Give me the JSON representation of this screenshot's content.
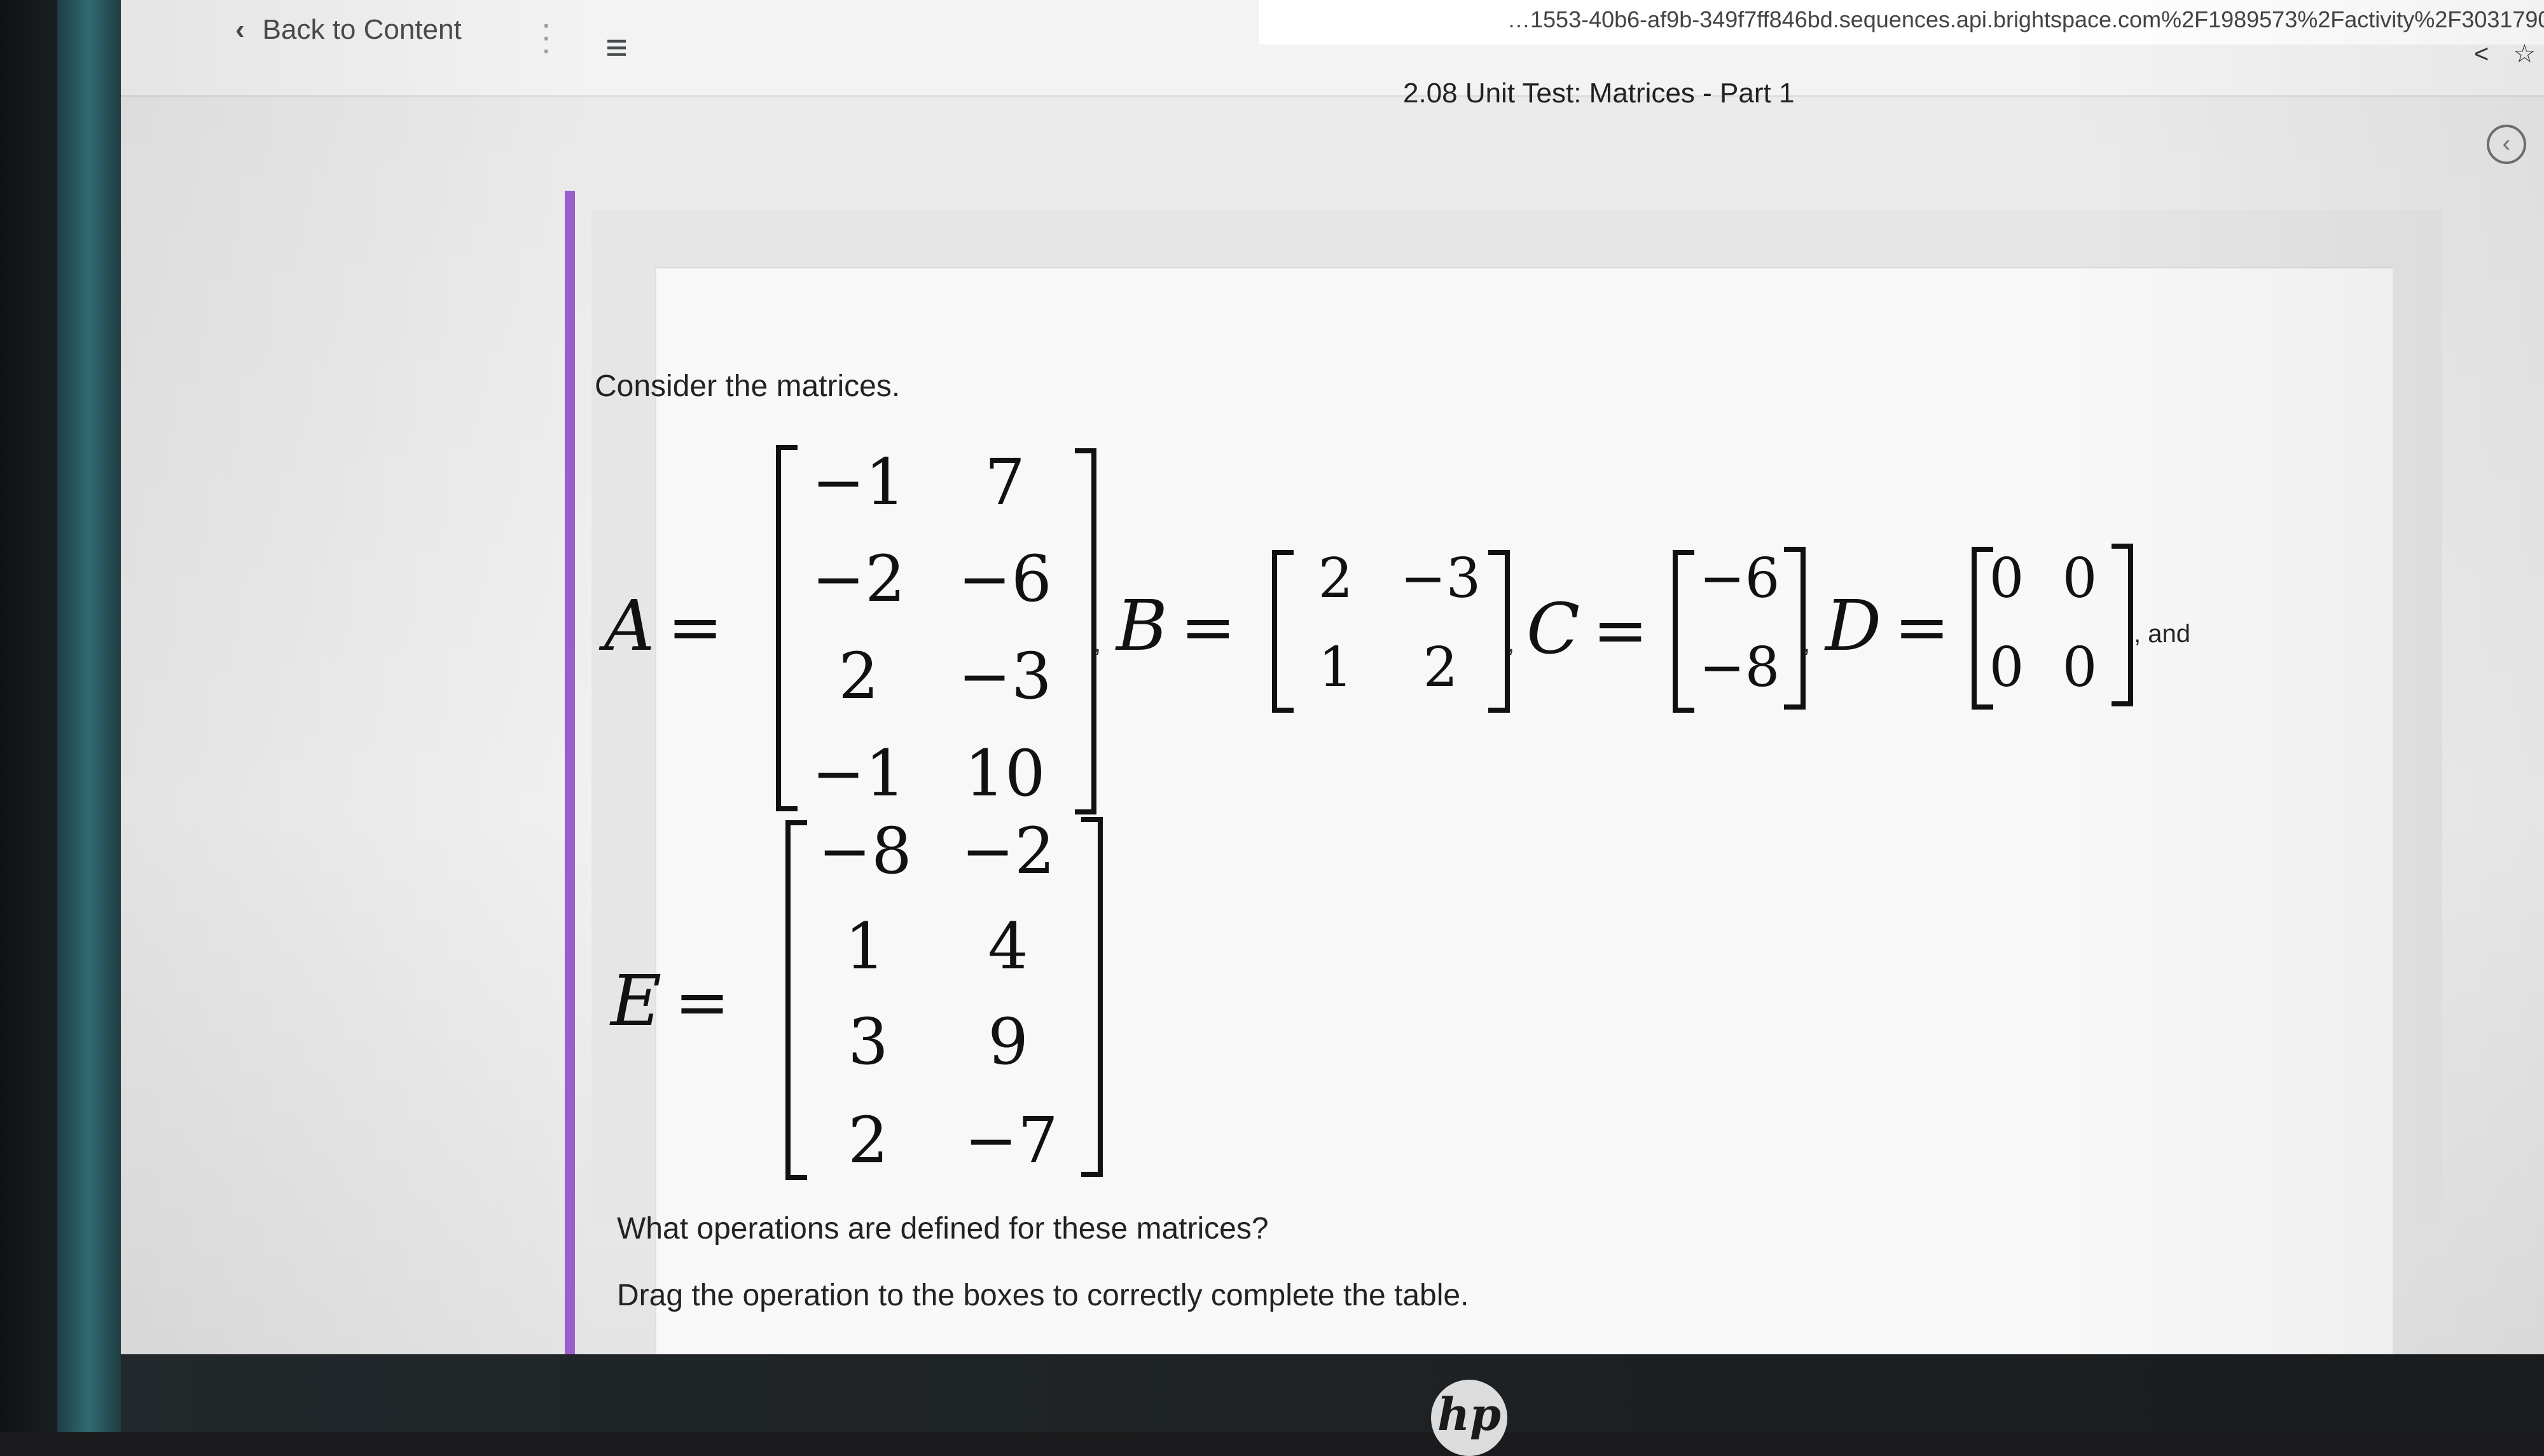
{
  "browser": {
    "url": "…1553-40b6-af9b-349f7ff846bd.sequences.api.brightspace.com%2F1989573%2Factivity%2F3031790…",
    "url_icons": [
      "share-icon",
      "star-icon",
      "extensions-icon",
      "window-icon"
    ]
  },
  "topbar": {
    "back_chevron": "‹",
    "back_label": "Back to Content",
    "menu_icon": "≡",
    "title": "2.08 Unit Test: Matrices - Part 1",
    "prev_icon": "‹",
    "next_icon": "›"
  },
  "question": {
    "intro": "Consider the matrices.",
    "and_text": ", and",
    "prompt1": "What operations are defined for these matrices?",
    "prompt2": "Drag the operation to the boxes to correctly complete the table."
  },
  "matrices": {
    "A": {
      "name": "A",
      "eq": "=",
      "rows": [
        [
          "−1",
          "7"
        ],
        [
          "−2",
          "−6"
        ],
        [
          "2",
          "−3"
        ],
        [
          "−1",
          "10"
        ]
      ]
    },
    "B": {
      "name": "B",
      "eq": "=",
      "rows": [
        [
          "2",
          "−3"
        ],
        [
          "1",
          "2"
        ]
      ]
    },
    "C": {
      "name": "C",
      "eq": "=",
      "rows": [
        [
          "−6"
        ],
        [
          "−8"
        ]
      ]
    },
    "D": {
      "name": "D",
      "eq": "=",
      "rows": [
        [
          "0",
          "0"
        ],
        [
          "0",
          "0"
        ]
      ]
    },
    "E": {
      "name": "E",
      "eq": "=",
      "rows": [
        [
          "−8",
          "−2"
        ],
        [
          "1",
          "4"
        ],
        [
          "3",
          "9"
        ],
        [
          "2",
          "−7"
        ]
      ]
    }
  },
  "hardware": {
    "logo": "hp"
  },
  "colors": {
    "accent_purple": "#9b5fcf",
    "page_bg": "#f1f1f1"
  }
}
